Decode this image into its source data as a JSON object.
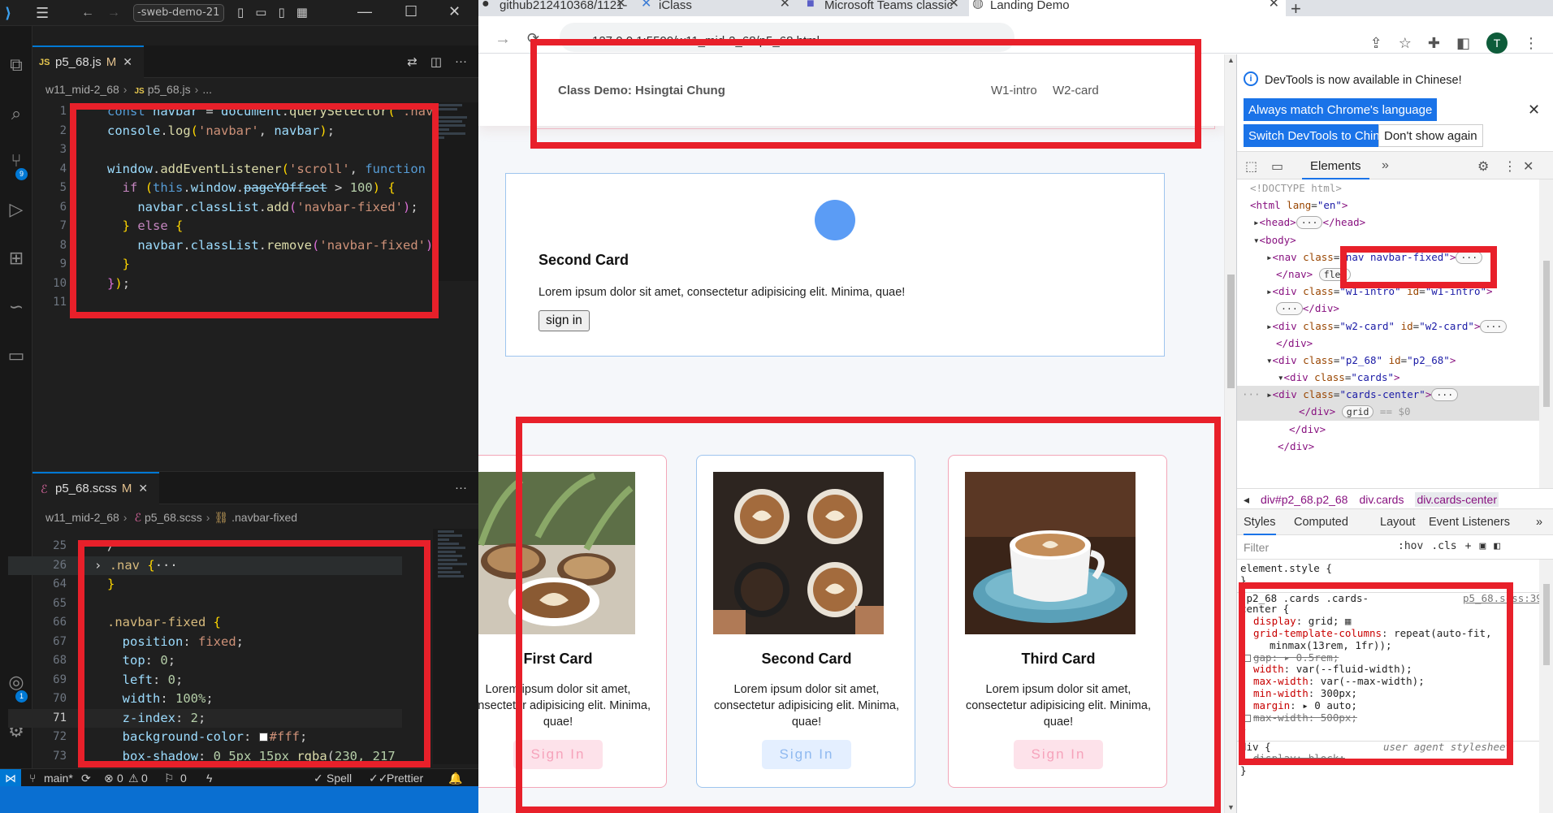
{
  "vscode": {
    "search_text": "-sweb-demo-21",
    "editor1": {
      "tab_label": "p5_68.js",
      "tab_modified": "M",
      "breadcrumb": [
        "w11_mid-2_68",
        "p5_68.js",
        "..."
      ],
      "lines": [
        {
          "num": "1"
        },
        {
          "num": "2"
        },
        {
          "num": "3"
        },
        {
          "num": "4"
        },
        {
          "num": "5"
        },
        {
          "num": "6"
        },
        {
          "num": "7"
        },
        {
          "num": "8"
        },
        {
          "num": "9"
        },
        {
          "num": "10"
        },
        {
          "num": "11"
        }
      ]
    },
    "editor2": {
      "tab_label": "p5_68.scss",
      "tab_modified": "M",
      "breadcrumb": [
        "w11_mid-2_68",
        "p5_68.scss",
        ".navbar-fixed"
      ],
      "lines": [
        {
          "num": "25"
        },
        {
          "num": "26"
        },
        {
          "num": "64"
        },
        {
          "num": "65"
        },
        {
          "num": "66"
        },
        {
          "num": "67"
        },
        {
          "num": "68"
        },
        {
          "num": "69"
        },
        {
          "num": "70"
        },
        {
          "num": "71"
        },
        {
          "num": "72"
        },
        {
          "num": "73"
        }
      ]
    },
    "activity_badges": {
      "source_control": "9",
      "account": "1"
    },
    "status": {
      "branch": "main*",
      "errors": "0",
      "warnings": "0",
      "ports": "0",
      "spell": "Spell",
      "prettier": "Prettier"
    }
  },
  "chrome": {
    "tabs": [
      {
        "label": "github212410368/1121-",
        "active": false
      },
      {
        "label": "iClass",
        "active": false
      },
      {
        "label": "Microsoft Teams classic",
        "active": false
      },
      {
        "label": "Landing Demo",
        "active": true
      }
    ],
    "url": "127.0.0.1:5500/w11_mid-2_68/p5_68.html",
    "avatar_letter": "T"
  },
  "page": {
    "brand": "Class Demo: Hsingtai Chung",
    "nav_links": [
      "W1-intro",
      "W2-card"
    ],
    "second_card": {
      "title": "Second Card",
      "text": "Lorem ipsum dolor sit amet, consectetur adipisicing elit. Minima, quae!",
      "button": "sign in"
    },
    "cards": [
      {
        "title": "First Card",
        "text": "Lorem ipsum dolor sit amet, consectetur adipisicing elit. Minima, quae!",
        "button": "Sign In",
        "theme": "pink",
        "image": "latte-art-with-plants"
      },
      {
        "title": "Second Card",
        "text": "Lorem ipsum dolor sit amet, consectetur adipisicing elit. Minima, quae!",
        "button": "Sign In",
        "theme": "blue",
        "image": "coffee-cups-cheers"
      },
      {
        "title": "Third Card",
        "text": "Lorem ipsum dolor sit amet, consectetur adipisicing elit. Minima, quae!",
        "button": "Sign In",
        "theme": "pink",
        "image": "cappuccino-blue-cup"
      }
    ]
  },
  "devtools": {
    "info_message": "DevTools is now available in Chinese!",
    "btn_match": "Always match Chrome's language",
    "btn_switch": "Switch DevTools to Chinese",
    "btn_dont_show": "Don't show again",
    "elements_tab": "Elements",
    "crumbs": [
      "div#p2_68.p2_68",
      "div.cards",
      "div.cards-center"
    ],
    "styles_tabs": [
      "Styles",
      "Computed",
      "Layout",
      "Event Listeners"
    ],
    "filter_placeholder": "Filter",
    "filter_hov": ":hov",
    "filter_cls": ".cls",
    "styles_source": "p5_68.scss:39",
    "ua_label": "user agent stylesheet"
  },
  "colors": {
    "annotation_red": "#e8202a",
    "vscode_accent": "#0078d4",
    "devtools_blue": "#1a73e8",
    "pink_button": "#fde2ea",
    "blue_button": "#e4efff"
  }
}
